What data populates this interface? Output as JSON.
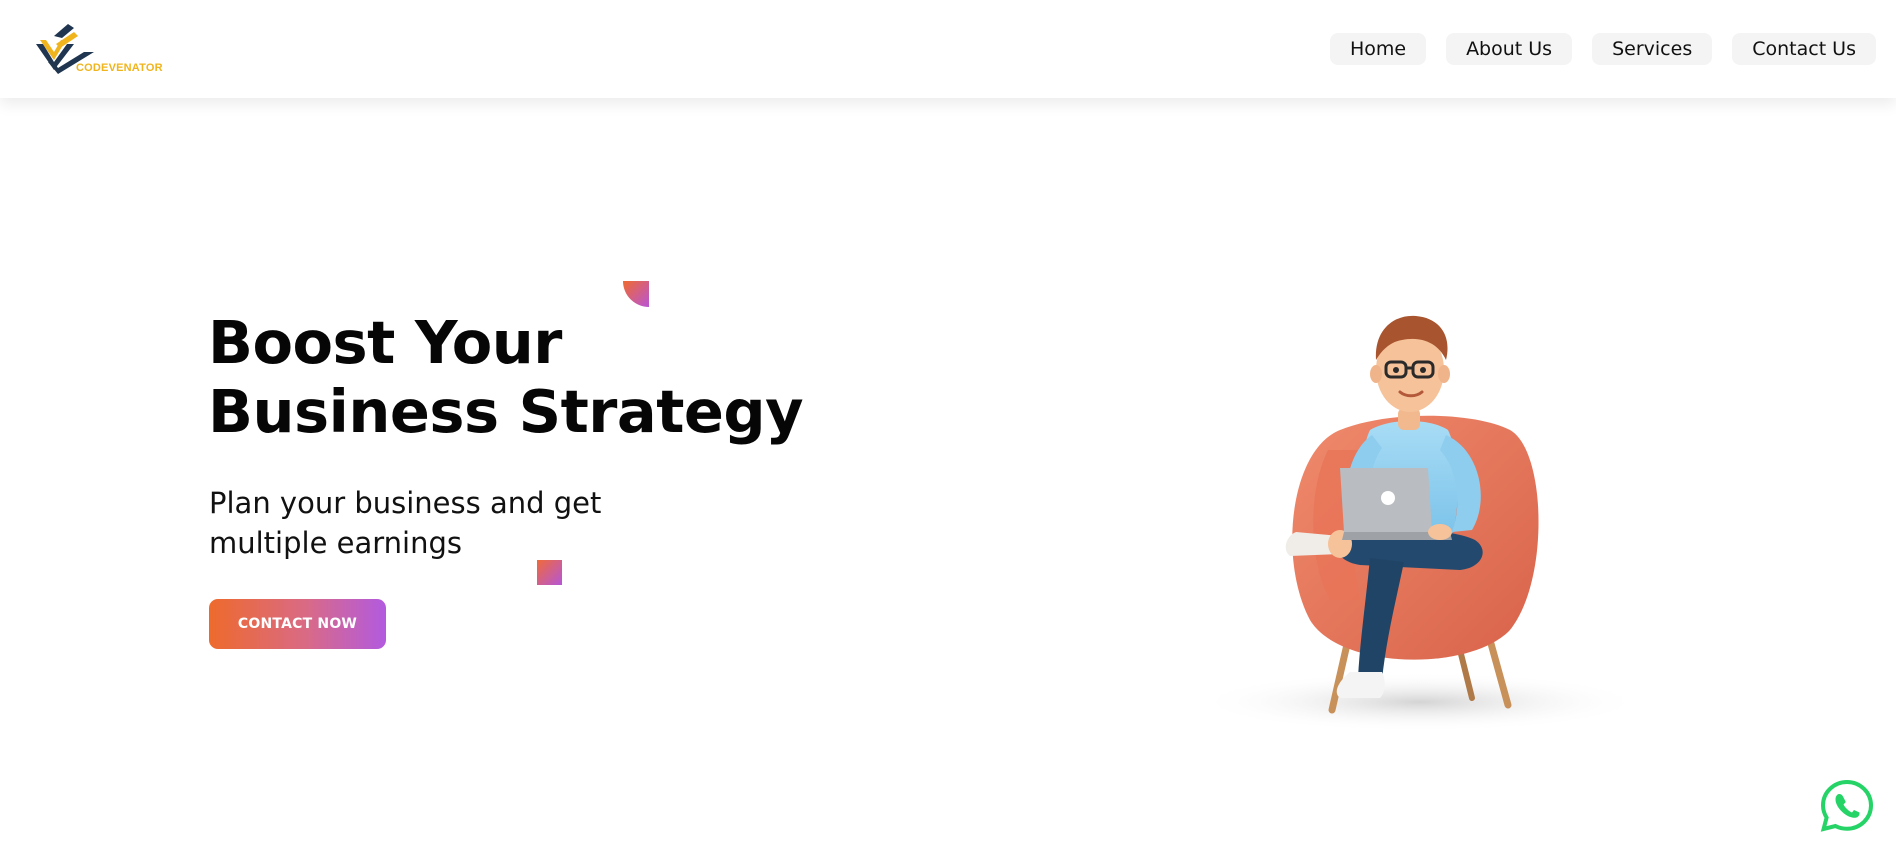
{
  "brand": {
    "name": "CODEVENATOR",
    "logo_icon": "codevenator-logo-icon",
    "colors": {
      "gold": "#f0b41c",
      "navy": "#1f3550"
    }
  },
  "nav": {
    "items": [
      {
        "label": "Home"
      },
      {
        "label": "About Us"
      },
      {
        "label": "Services"
      },
      {
        "label": "Contact Us"
      }
    ]
  },
  "hero": {
    "title_line1": "Boost Your",
    "title_line2": "Business Strategy",
    "subtitle_line1": "Plan your business and get",
    "subtitle_line2": "multiple earnings",
    "cta_label": "CONTACT NOW",
    "cta_gradient": [
      "#ee6a2c",
      "#b25ae0"
    ],
    "illustration": "man-on-armchair-with-laptop-illustration"
  },
  "floating": {
    "whatsapp_icon": "whatsapp-icon",
    "whatsapp_color": "#25d366"
  }
}
